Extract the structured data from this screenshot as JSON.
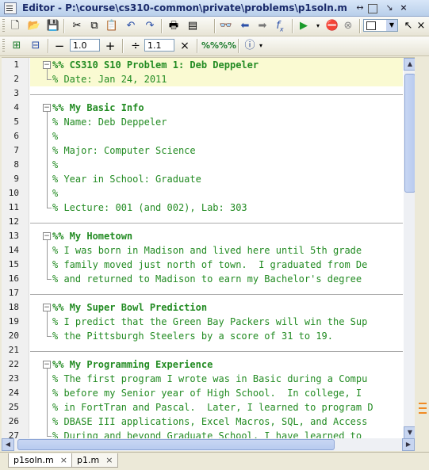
{
  "window": {
    "title": "Editor - P:\\course\\cs310-common\\private\\problems\\p1soln.m"
  },
  "toolbar2": {
    "value1": "1.0",
    "value2": "1.1"
  },
  "editor": {
    "lines": [
      {
        "n": "1",
        "text": "%% CS310 S10 Problem 1: Deb Deppeler",
        "hdr": true
      },
      {
        "n": "2",
        "text": "% Date: Jan 24, 2011"
      },
      {
        "n": "3",
        "text": ""
      },
      {
        "n": "4",
        "text": "%% My Basic Info",
        "hdr": true
      },
      {
        "n": "5",
        "text": "% Name: Deb Deppeler"
      },
      {
        "n": "6",
        "text": "%"
      },
      {
        "n": "7",
        "text": "% Major: Computer Science"
      },
      {
        "n": "8",
        "text": "%"
      },
      {
        "n": "9",
        "text": "% Year in School: Graduate"
      },
      {
        "n": "10",
        "text": "%"
      },
      {
        "n": "11",
        "text": "% Lecture: 001 (and 002), Lab: 303"
      },
      {
        "n": "12",
        "text": ""
      },
      {
        "n": "13",
        "text": "%% My Hometown",
        "hdr": true
      },
      {
        "n": "14",
        "text": "% I was born in Madison and lived here until 5th grade"
      },
      {
        "n": "15",
        "text": "% family moved just north of town.  I graduated from De"
      },
      {
        "n": "16",
        "text": "% and returned to Madison to earn my Bachelor's degree"
      },
      {
        "n": "17",
        "text": ""
      },
      {
        "n": "18",
        "text": "%% My Super Bowl Prediction",
        "hdr": true
      },
      {
        "n": "19",
        "text": "% I predict that the Green Bay Packers will win the Sup"
      },
      {
        "n": "20",
        "text": "% the Pittsburgh Steelers by a score of 31 to 19."
      },
      {
        "n": "21",
        "text": ""
      },
      {
        "n": "22",
        "text": "%% My Programming Experience",
        "hdr": true
      },
      {
        "n": "23",
        "text": "% The first program I wrote was in Basic during a Compu"
      },
      {
        "n": "24",
        "text": "% before my Senior year of High School.  In college, I"
      },
      {
        "n": "25",
        "text": "% in FortTran and Pascal.  Later, I learned to program D"
      },
      {
        "n": "26",
        "text": "% DBASE III applications, Excel Macros, SQL, and Access"
      },
      {
        "n": "27",
        "text": "% During and beyond Graduate School, I have learned to"
      }
    ]
  },
  "tabs": [
    {
      "label": "p1soln.m",
      "close": "×"
    },
    {
      "label": "p1.m",
      "close": "×"
    }
  ],
  "colors": {
    "comment": "#228b22",
    "cell_highlight": "#fafad2",
    "marker": "#f08a24"
  }
}
